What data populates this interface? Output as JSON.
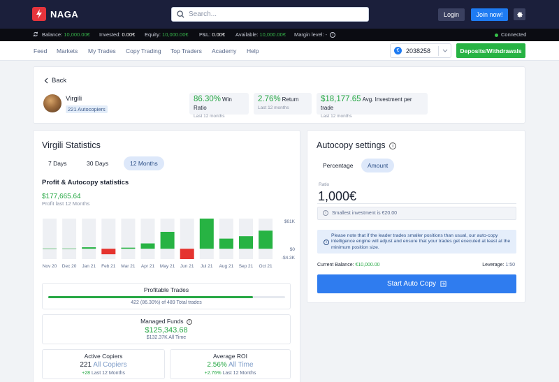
{
  "brand": {
    "name": "NAGA"
  },
  "header": {
    "search_placeholder": "Search...",
    "login_label": "Login",
    "join_label": "Join now!"
  },
  "status": {
    "balance_label": "Balance:",
    "balance_value": "10,000.00€",
    "invested_label": "Invested:",
    "invested_value": "0.00€",
    "equity_label": "Equity:",
    "equity_value": "10,000.00€",
    "pl_label": "P&L:",
    "pl_value": "0.00€",
    "available_label": "Available:",
    "available_value": "10,000.00€",
    "margin_label": "Margin level:",
    "margin_value": "-",
    "connection": "Connected"
  },
  "nav": {
    "items": [
      "Feed",
      "Markets",
      "My Trades",
      "Copy Trading",
      "Top Traders",
      "Academy",
      "Help"
    ],
    "account_number": "2038258",
    "deposit_label": "Deposits/Withdrawals"
  },
  "profile": {
    "back_label": "Back",
    "name": "Virgili",
    "autocopiers": "221 Autocopiers",
    "stats": [
      {
        "value": "86.30%",
        "label": "Win Ratio",
        "sub": "Last 12 months"
      },
      {
        "value": "2.76%",
        "label": "Return",
        "sub": "Last 12 months"
      },
      {
        "value": "$18,177.65",
        "label": "Avg. Investment per trade",
        "sub": "Last 12 months"
      }
    ]
  },
  "statistics": {
    "title": "Virgili Statistics",
    "periods": [
      "7 Days",
      "30 Days",
      "12 Months"
    ],
    "active_period": "12 Months",
    "profit_title": "Profit & Autocopy statistics",
    "profit_value": "$177,665.64",
    "profit_sub": "Profit last 12 Months",
    "profitable_trades_title": "Profitable Trades",
    "profitable_fraction": 0.863,
    "profitable_sub": "422 (86.30%) of 489 Total trades",
    "managed_funds_title": "Managed Funds",
    "managed_funds_value": "$125,343.68",
    "managed_funds_sub": "$132.37K All Time",
    "active_copiers_title": "Active Copiers",
    "active_copiers_value": "221",
    "active_copiers_all": "All Copiers",
    "active_copiers_change": "+28",
    "active_copiers_period": "Last 12 Months",
    "avg_roi_title": "Average ROI",
    "avg_roi_value": "2.56%",
    "avg_roi_all": "All Time",
    "avg_roi_change": "+2.76%",
    "avg_roi_period": "Last 12 Months"
  },
  "chart_data": {
    "type": "bar",
    "categories": [
      "Nov 20",
      "Dec 20",
      "Jan 21",
      "Feb 21",
      "Mar 21",
      "Apr 21",
      "May 21",
      "Jun 21",
      "Jul 21",
      "Aug 21",
      "Sep 21",
      "Oct 21"
    ],
    "values": [
      0,
      0,
      0.6,
      -2.3,
      0.4,
      2.2,
      7.0,
      -4.3,
      12.5,
      4.2,
      5.2,
      7.5
    ],
    "ylim": [
      -4.3,
      12.5
    ],
    "ytick_labels": [
      "$61K",
      "$0",
      "-$4.3K"
    ],
    "colors": {
      "positive": "#27b343",
      "negative": "#e5342f",
      "background": "#eef0f4"
    }
  },
  "autocopy": {
    "title": "Autocopy settings",
    "tabs": [
      "Percentage",
      "Amount"
    ],
    "active_tab": "Amount",
    "ratio_label": "Ratio",
    "ratio_value": "1,000€",
    "min_note": "Smallest investment is €20.00",
    "info_note": "Please note that if the leader trades smaller positions than usual, our auto-copy intelligence engine will adjust and ensure that your trades get executed at least at the minimum position size.",
    "balance_label": "Current Balance:",
    "balance_value": "€10,000.00",
    "leverage_label": "Leverage:",
    "leverage_value": "1:50",
    "start_label": "Start Auto Copy"
  }
}
